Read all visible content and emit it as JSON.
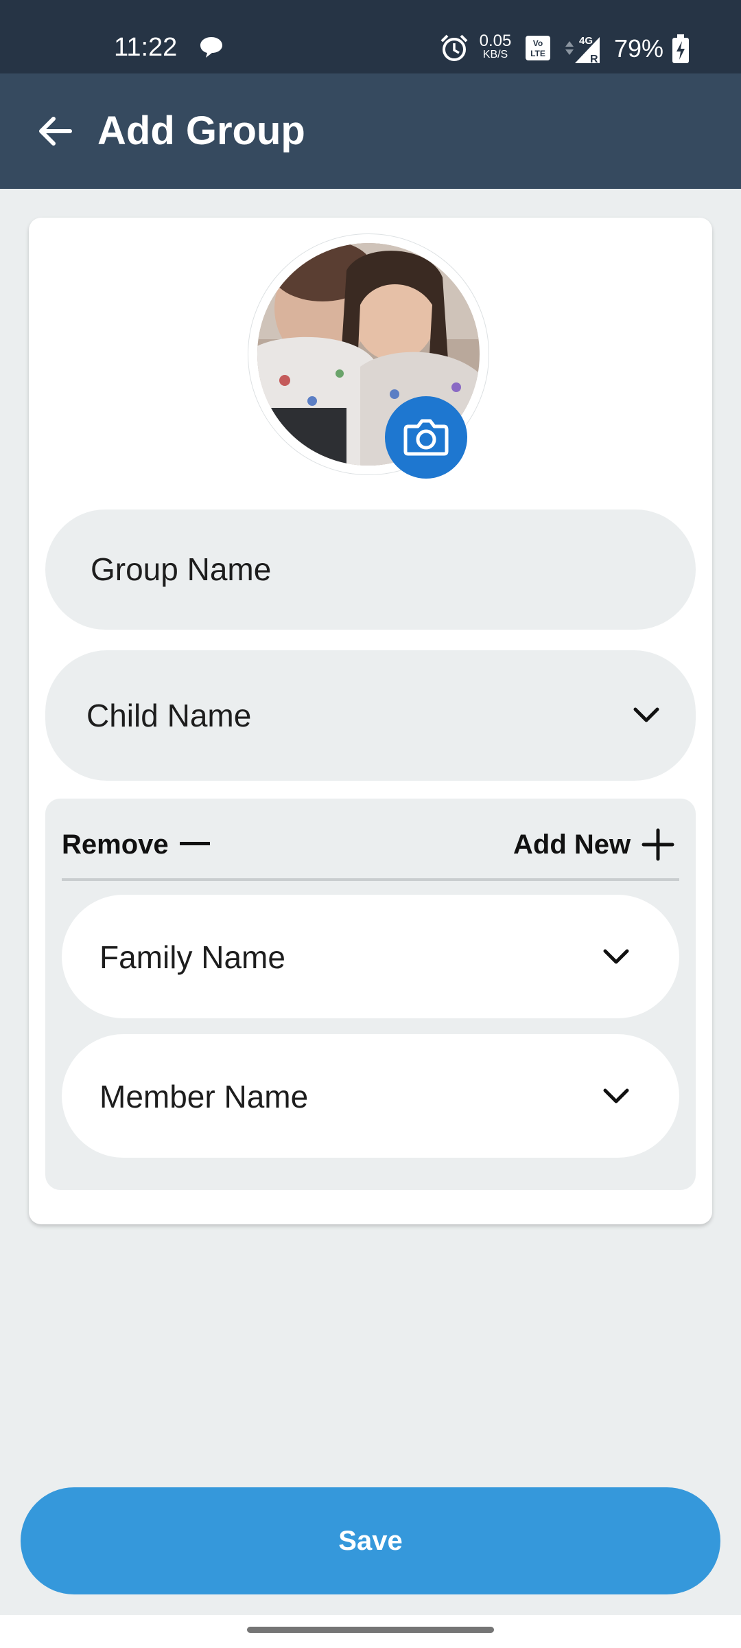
{
  "status_bar": {
    "time": "11:22",
    "net_speed_value": "0.05",
    "net_speed_unit": "KB/S",
    "network_type": "4G",
    "battery_percent": "79%"
  },
  "app_bar": {
    "title": "Add Group"
  },
  "form": {
    "group_name_placeholder": "Group Name",
    "child_name_placeholder": "Child Name",
    "members": {
      "remove_label": "Remove",
      "add_new_label": "Add New",
      "family_name_placeholder": "Family Name",
      "member_name_placeholder": "Member Name"
    }
  },
  "actions": {
    "save_label": "Save"
  },
  "colors": {
    "status_bar": "#263445",
    "app_bar": "#364A5F",
    "background": "#EBEEEF",
    "camera_button": "#1E77D0",
    "save_button": "#3598DB"
  }
}
